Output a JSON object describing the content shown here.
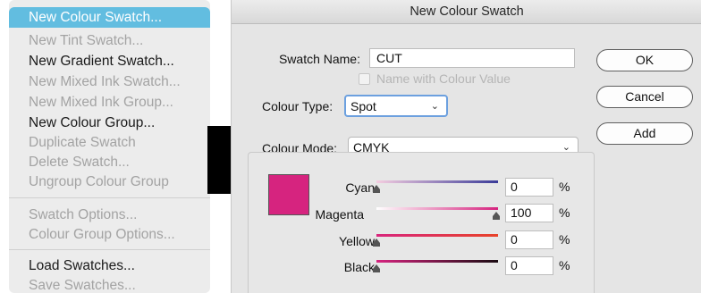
{
  "menu": {
    "items": [
      {
        "label": "New Colour Swatch...",
        "state": "selected"
      },
      {
        "label": "New Tint Swatch...",
        "state": "disabled"
      },
      {
        "label": "New Gradient Swatch...",
        "state": "enabled"
      },
      {
        "label": "New Mixed Ink Swatch...",
        "state": "disabled"
      },
      {
        "label": "New Mixed Ink Group...",
        "state": "disabled"
      },
      {
        "label": "New Colour Group...",
        "state": "enabled"
      },
      {
        "label": "Duplicate Swatch",
        "state": "disabled"
      },
      {
        "label": "Delete Swatch...",
        "state": "disabled"
      },
      {
        "label": "Ungroup Colour Group",
        "state": "disabled"
      },
      {
        "label": "Swatch Options...",
        "state": "disabled"
      },
      {
        "label": "Colour Group Options...",
        "state": "disabled"
      },
      {
        "label": "Load Swatches...",
        "state": "enabled"
      },
      {
        "label": "Save Swatches...",
        "state": "disabled"
      }
    ]
  },
  "dialog": {
    "title": "New Colour Swatch",
    "swatch_name_label": "Swatch Name:",
    "swatch_name_value": "CUT",
    "name_with_colour_value_label": "Name with Colour Value",
    "colour_type_label": "Colour Type:",
    "colour_type_value": "Spot",
    "colour_mode_label": "Colour Mode:",
    "colour_mode_value": "CMYK",
    "buttons": {
      "ok": "OK",
      "cancel": "Cancel",
      "add": "Add"
    },
    "swatch_preview_color": "#d6247f",
    "sliders": [
      {
        "label": "Cyan",
        "value": "0",
        "unit": "%",
        "fraction": 0.0
      },
      {
        "label": "Magenta",
        "value": "100",
        "unit": "%",
        "fraction": 1.0
      },
      {
        "label": "Yellow",
        "value": "0",
        "unit": "%",
        "fraction": 0.0
      },
      {
        "label": "Black",
        "value": "0",
        "unit": "%",
        "fraction": 0.0
      }
    ]
  },
  "colors": {
    "menu_selection": "#62bde0",
    "select_focus": "#6ca0df"
  },
  "icons": {
    "dropdown": "chevron-down-icon",
    "slider_thumb": "slider-thumb-icon"
  }
}
